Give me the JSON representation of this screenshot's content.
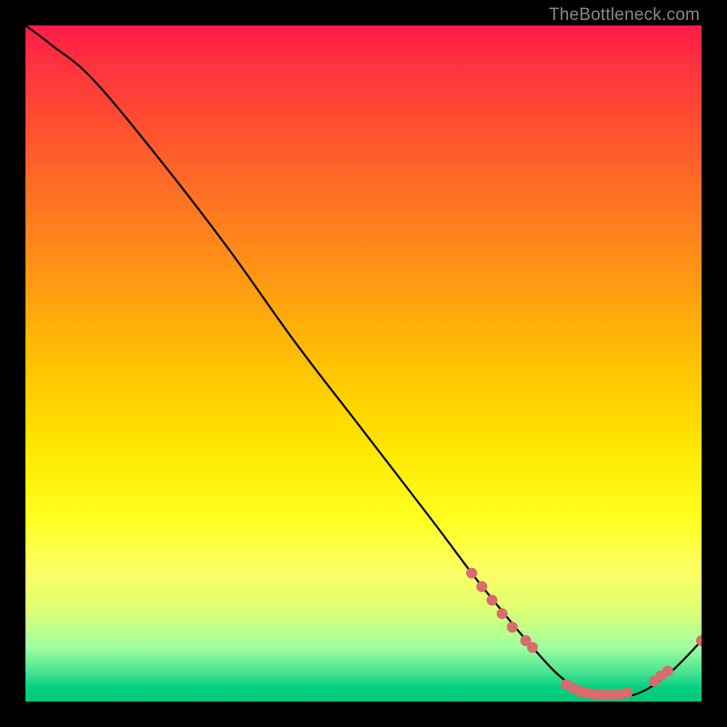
{
  "watermark": "TheBottleneck.com",
  "chart_data": {
    "type": "line",
    "title": "",
    "xlabel": "",
    "ylabel": "",
    "xlim": [
      0,
      100
    ],
    "ylim": [
      0,
      100
    ],
    "grid": false,
    "series": [
      {
        "name": "curve",
        "x": [
          0,
          4,
          10,
          20,
          30,
          40,
          50,
          60,
          66,
          70,
          75,
          80,
          85,
          90,
          95,
          100
        ],
        "y": [
          100,
          97,
          92,
          80,
          67,
          53,
          40,
          27,
          19,
          14,
          8,
          3,
          1,
          1,
          4,
          9
        ],
        "color": "#000000"
      }
    ],
    "points": [
      {
        "x": 66,
        "y": 19
      },
      {
        "x": 67.5,
        "y": 17
      },
      {
        "x": 69,
        "y": 15
      },
      {
        "x": 70.5,
        "y": 13
      },
      {
        "x": 72,
        "y": 11
      },
      {
        "x": 74,
        "y": 9
      },
      {
        "x": 75,
        "y": 8
      },
      {
        "x": 80,
        "y": 2.5
      },
      {
        "x": 81,
        "y": 2
      },
      {
        "x": 82,
        "y": 1.5
      },
      {
        "x": 83,
        "y": 1.3
      },
      {
        "x": 84,
        "y": 1.1
      },
      {
        "x": 85,
        "y": 1
      },
      {
        "x": 86,
        "y": 1
      },
      {
        "x": 87,
        "y": 1
      },
      {
        "x": 88,
        "y": 1.1
      },
      {
        "x": 89,
        "y": 1.3
      },
      {
        "x": 93,
        "y": 3
      },
      {
        "x": 94,
        "y": 3.8
      },
      {
        "x": 95,
        "y": 4.5
      },
      {
        "x": 100,
        "y": 9
      }
    ],
    "point_color": "#d86b6b",
    "point_radius": 6
  }
}
